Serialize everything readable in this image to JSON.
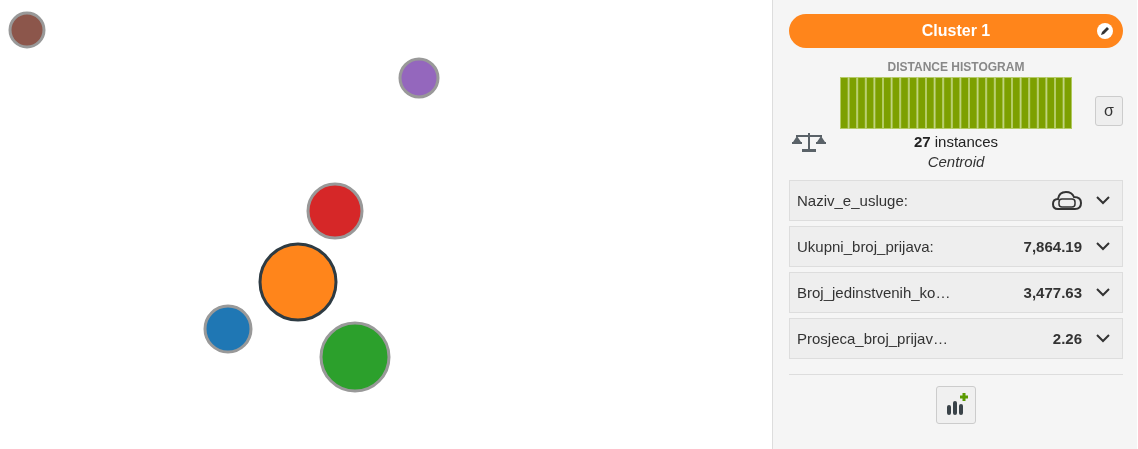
{
  "clusters": [
    {
      "color": "#8c564b",
      "selected": false
    },
    {
      "color": "#9467bd",
      "selected": false
    },
    {
      "color": "#d62728",
      "selected": false
    },
    {
      "color": "#ff851b",
      "selected": true
    },
    {
      "color": "#1f77b4",
      "selected": false
    },
    {
      "color": "#2ca02c",
      "selected": false
    }
  ],
  "panel": {
    "title": "Cluster 1",
    "histogram_title": "DISTANCE HISTOGRAM",
    "sigma_button": "σ",
    "instances_count": "27",
    "instances_label": "instances",
    "centroid_label": "Centroid",
    "fields": [
      {
        "kind": "text",
        "name": "Naziv_e_usluge:"
      },
      {
        "kind": "numeric",
        "name": "Ukupni_broj_prijava:",
        "value": "7,864.19"
      },
      {
        "kind": "numeric",
        "name": "Broj_jedinstvenih_ko…",
        "value": "3,477.63"
      },
      {
        "kind": "numeric",
        "name": "Prosjeca_broj_prijav…",
        "value": "2.26"
      }
    ]
  }
}
